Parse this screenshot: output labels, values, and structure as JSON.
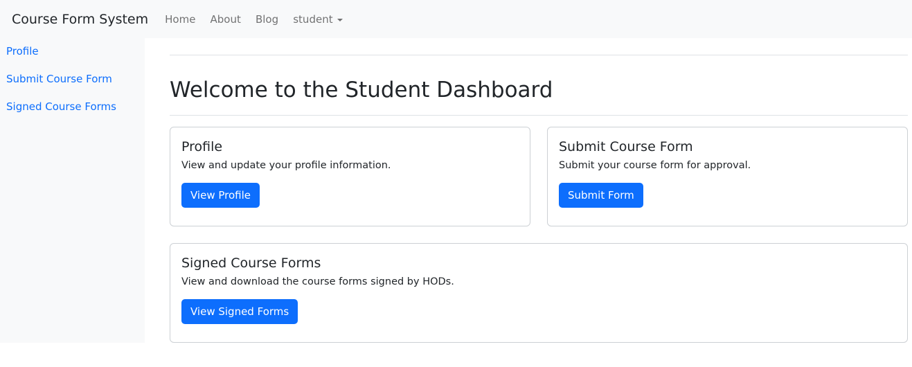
{
  "navbar": {
    "brand": "Course Form System",
    "links": [
      "Home",
      "About",
      "Blog"
    ],
    "dropdown": "student"
  },
  "sidebar": {
    "items": [
      "Profile",
      "Submit Course Form",
      "Signed Course Forms"
    ]
  },
  "main": {
    "title": "Welcome to the Student Dashboard",
    "cards": [
      {
        "title": "Profile",
        "text": "View and update your profile information.",
        "button": "View Profile"
      },
      {
        "title": "Submit Course Form",
        "text": "Submit your course form for approval.",
        "button": "Submit Form"
      },
      {
        "title": "Signed Course Forms",
        "text": "View and download the course forms signed by HODs.",
        "button": "View Signed Forms"
      }
    ]
  },
  "colors": {
    "primary": "#0d6efd",
    "navbar_bg": "#f8f9fa"
  }
}
